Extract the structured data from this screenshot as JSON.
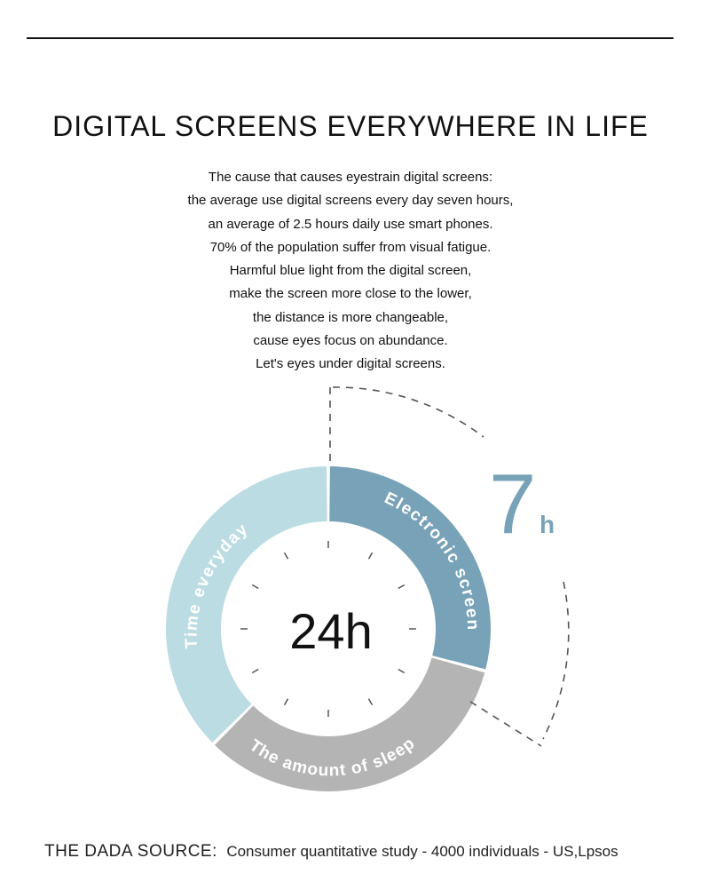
{
  "title": "DIGITAL SCREENS EVERYWHERE IN LIFE",
  "description": [
    "The cause that causes eyestrain digital screens:",
    "the average use digital screens every day seven hours,",
    "an average of 2.5 hours daily use smart phones.",
    "70% of the population suffer from visual fatigue.",
    "Harmful blue light from the digital screen,",
    "make the screen more close to the lower,",
    "the distance is more changeable,",
    "cause eyes focus on abundance.",
    "Let's eyes under digital screens."
  ],
  "chart_data": {
    "type": "pie",
    "center_label": "24h",
    "segments": [
      {
        "label": "Electronic screens",
        "hours": 7,
        "color": "#78a2b8"
      },
      {
        "label": "The amount of sleep",
        "hours": 8,
        "color": "#b4b4b4"
      },
      {
        "label": "Time everyday",
        "hours": 9,
        "color": "#bcdce3"
      }
    ],
    "highlight": {
      "number": "7",
      "unit": "h",
      "color": "#78a2b8"
    }
  },
  "source": {
    "label": "THE DADA SOURCE:",
    "text": "Consumer quantitative study - 4000 individuals - US,Lpsos"
  }
}
